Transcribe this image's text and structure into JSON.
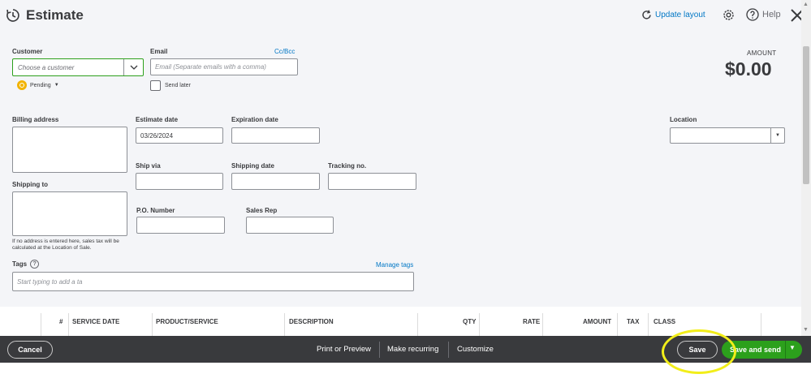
{
  "header": {
    "title": "Estimate",
    "update_layout": "Update layout",
    "help": "Help"
  },
  "customer": {
    "label": "Customer",
    "placeholder": "Choose a customer",
    "status": "Pending"
  },
  "email": {
    "label": "Email",
    "cc_bcc": "Cc/Bcc",
    "placeholder": "Email (Separate emails with a comma)",
    "send_later": "Send later"
  },
  "amount": {
    "label": "AMOUNT",
    "value": "$0.00"
  },
  "billing_address": {
    "label": "Billing address"
  },
  "shipping_to": {
    "label": "Shipping to"
  },
  "address_note": "If no address is entered here, sales tax will be calculated at the Location of Sale.",
  "estimate_date": {
    "label": "Estimate date",
    "value": "03/26/2024"
  },
  "expiration_date": {
    "label": "Expiration date",
    "value": ""
  },
  "location": {
    "label": "Location",
    "value": ""
  },
  "ship_via": {
    "label": "Ship via",
    "value": ""
  },
  "shipping_date": {
    "label": "Shipping date",
    "value": ""
  },
  "tracking_no": {
    "label": "Tracking no.",
    "value": ""
  },
  "po_number": {
    "label": "P.O. Number",
    "value": ""
  },
  "sales_rep": {
    "label": "Sales Rep",
    "value": ""
  },
  "tags": {
    "label": "Tags",
    "manage": "Manage tags",
    "placeholder": "Start typing to add a ta"
  },
  "table": {
    "columns": [
      "#",
      "SERVICE DATE",
      "PRODUCT/SERVICE",
      "DESCRIPTION",
      "QTY",
      "RATE",
      "AMOUNT",
      "TAX",
      "CLASS"
    ]
  },
  "footer": {
    "cancel": "Cancel",
    "print_preview": "Print or Preview",
    "make_recurring": "Make recurring",
    "customize": "Customize",
    "save": "Save",
    "save_and_send": "Save and send"
  },
  "colors": {
    "accent_green": "#2ca01c",
    "link_blue": "#0077c5",
    "footer_bg": "#393a3d",
    "highlight_yellow": "#f2ee1a"
  }
}
